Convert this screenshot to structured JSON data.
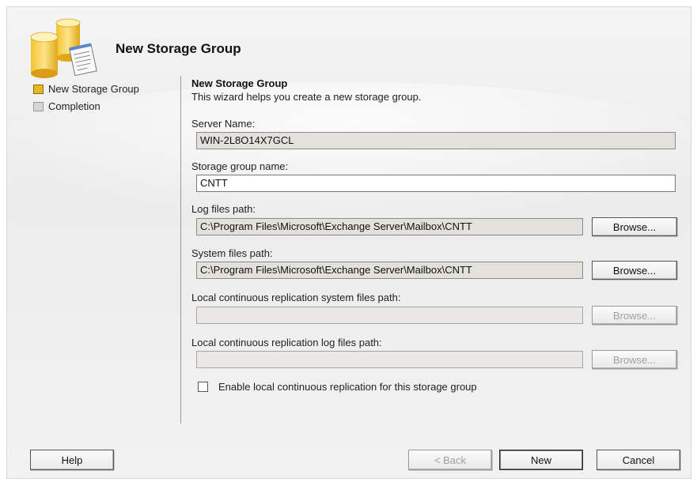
{
  "header": {
    "title": "New Storage Group"
  },
  "nav": {
    "items": [
      {
        "label": "New Storage Group",
        "state": "active"
      },
      {
        "label": "Completion",
        "state": "inactive"
      }
    ]
  },
  "content": {
    "section_title": "New Storage Group",
    "description": "This wizard helps you create a new storage group.",
    "server_name_label": "Server Name:",
    "server_name_value": "WIN-2L8O14X7GCL",
    "storage_group_label": "Storage group name:",
    "storage_group_value": "CNTT",
    "log_path_label": "Log files path:",
    "log_path_value": "C:\\Program Files\\Microsoft\\Exchange Server\\Mailbox\\CNTT",
    "system_path_label": "System files path:",
    "system_path_value": "C:\\Program Files\\Microsoft\\Exchange Server\\Mailbox\\CNTT",
    "lcr_system_label": "Local continuous replication system files path:",
    "lcr_system_value": "",
    "lcr_log_label": "Local continuous replication log files path:",
    "lcr_log_value": "",
    "browse_label": "Browse...",
    "enable_lcr_label": "Enable local continuous replication for this storage group",
    "enable_lcr_checked": false
  },
  "footer": {
    "help": "Help",
    "back": "< Back",
    "new": "New",
    "cancel": "Cancel"
  },
  "colors": {
    "active_step": "#e8b820",
    "inactive_step": "#d6d6d6",
    "readonly_field": "#e3e1dc"
  }
}
